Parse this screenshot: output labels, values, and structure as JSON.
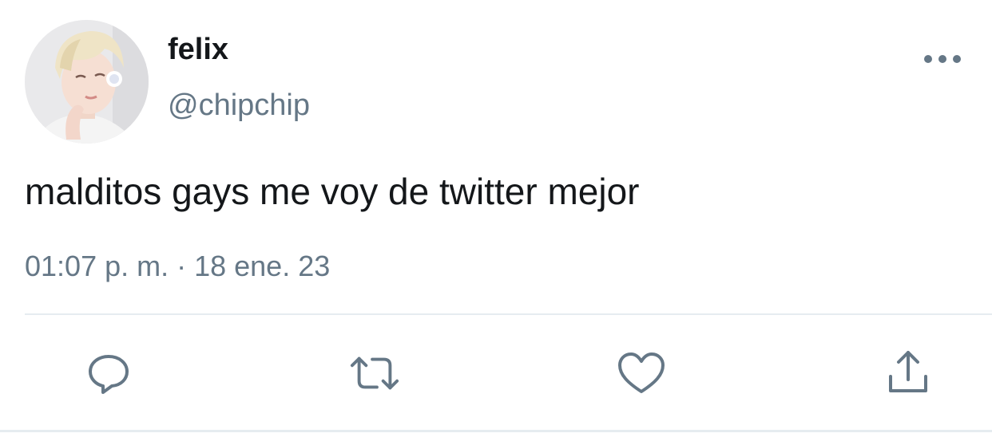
{
  "user": {
    "display_name": "felix",
    "handle": "@chipchip"
  },
  "tweet": {
    "text": "malditos gays me voy de twitter mejor",
    "timestamp": "01:07 p. m. · 18 ene. 23"
  },
  "icons": {
    "more": "more-horizontal-icon",
    "reply": "reply-icon",
    "retweet": "retweet-icon",
    "like": "heart-icon",
    "share": "share-icon"
  },
  "colors": {
    "text_primary": "#14171a",
    "text_secondary": "#657786",
    "divider": "#e6ecf0",
    "icon": "#657786"
  }
}
